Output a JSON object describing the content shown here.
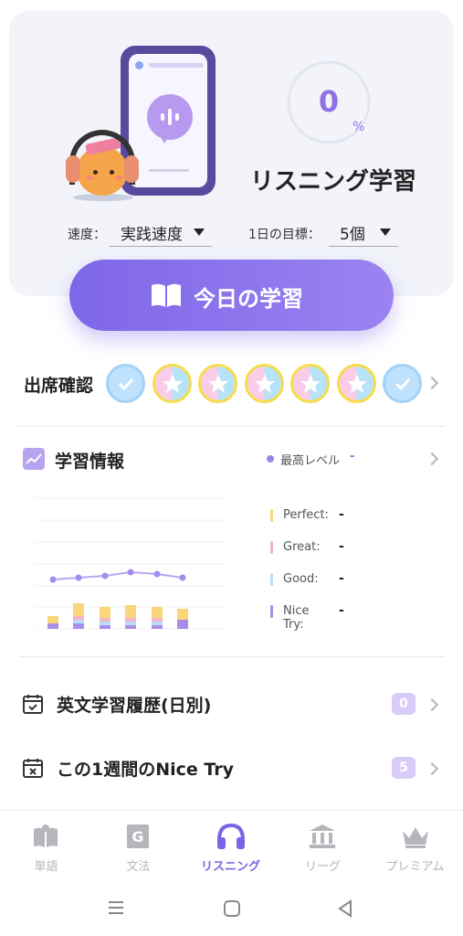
{
  "hero": {
    "progress_value": "0",
    "progress_unit": "%",
    "progress_fraction": 0,
    "title": "リスニング学習",
    "speed_label": "速度：",
    "speed_value": "実践速度",
    "goal_label": "1日の目標：",
    "goal_value": "5個",
    "study_button": "今日の学習"
  },
  "attendance": {
    "title": "出席確認",
    "badges": [
      "check",
      "star",
      "star",
      "star",
      "star",
      "star",
      "check"
    ]
  },
  "study_info": {
    "title": "学習情報",
    "max_level_label": "最高レベル",
    "max_level_value": "-",
    "legend": [
      {
        "name": "Perfect:",
        "value": "-",
        "color": "#f9d67a"
      },
      {
        "name": "Great:",
        "value": "-",
        "color": "#f5b5c8"
      },
      {
        "name": "Good:",
        "value": "-",
        "color": "#b9def8"
      },
      {
        "name": "Nice Try:",
        "value": "-",
        "color": "#a98ee9"
      }
    ]
  },
  "list": {
    "history_label": "英文学習履歴(日別)",
    "history_count": "0",
    "nicetry_label": "この1週間のNice Try",
    "nicetry_count": "5"
  },
  "nav": {
    "items": [
      {
        "label": "単語",
        "icon": "book-icon"
      },
      {
        "label": "文法",
        "icon": "grammar-icon"
      },
      {
        "label": "リスニング",
        "icon": "headphones-icon"
      },
      {
        "label": "リーグ",
        "icon": "league-icon"
      },
      {
        "label": "プレミアム",
        "icon": "crown-icon"
      }
    ],
    "active_index": 2
  },
  "colors": {
    "accent": "#7c62e6",
    "hero_bg": "#f2f4fa"
  }
}
